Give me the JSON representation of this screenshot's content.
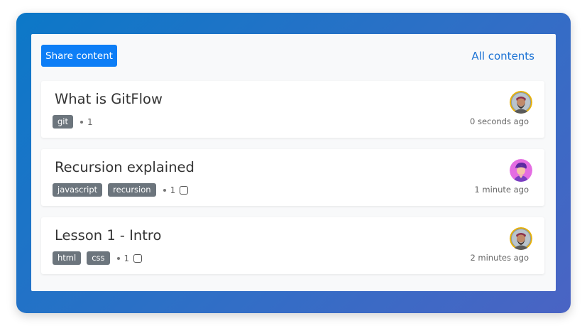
{
  "header": {
    "share_label": "Share content",
    "all_contents_label": "All contents"
  },
  "posts": [
    {
      "title": "What is GitFlow",
      "tags": [
        "git"
      ],
      "count": "1",
      "has_box_icon": false,
      "time": "0 seconds ago",
      "avatar": "bearded-man-avatar"
    },
    {
      "title": "Recursion explained",
      "tags": [
        "javascript",
        "recursion"
      ],
      "count": "1",
      "has_box_icon": true,
      "time": "1 minute ago",
      "avatar": "purple-hair-avatar"
    },
    {
      "title": "Lesson 1 - Intro",
      "tags": [
        "html",
        "css"
      ],
      "count": "1",
      "has_box_icon": true,
      "time": "2 minutes ago",
      "avatar": "bearded-man-avatar"
    }
  ],
  "colors": {
    "primary": "#0d7ef6",
    "link": "#1b72d4",
    "tag": "#6c757d",
    "frame_start": "#0c78c8",
    "frame_end": "#4a64c4"
  }
}
